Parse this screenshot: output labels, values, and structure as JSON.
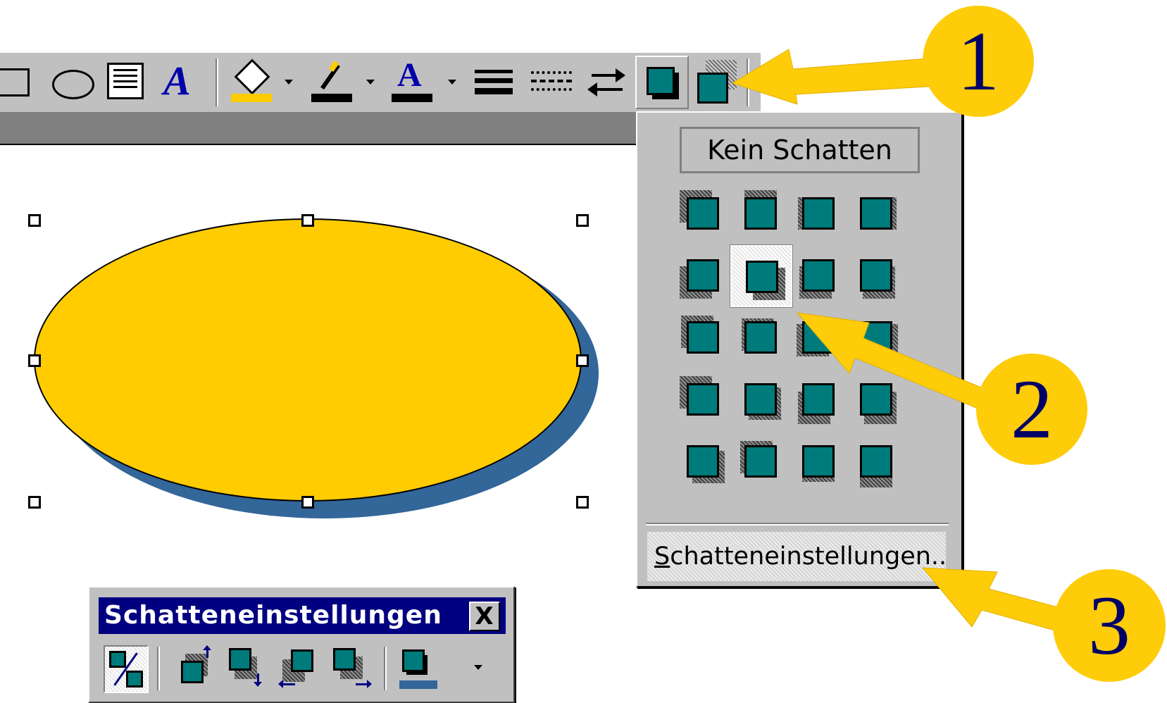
{
  "toolbar": {
    "tools": [
      "rectangle-icon",
      "oval-icon",
      "text-box-icon",
      "wordart-icon",
      "fill-color-icon",
      "line-color-icon",
      "font-color-icon",
      "line-style-icon",
      "dash-style-icon",
      "arrow-style-icon",
      "shadow-icon",
      "3d-icon"
    ],
    "font_color_glyph": "A"
  },
  "shadow_menu": {
    "no_shadow_label": "Kein Schatten",
    "settings_label_first": "S",
    "settings_label_rest": "chatteneinstellungen...",
    "shadow_style_count": 20,
    "selected_style": 6
  },
  "shadow_toolbar": {
    "title": "Schatteneinstellungen",
    "close_glyph": "X",
    "buttons": [
      "shadow-on-off-icon",
      "nudge-shadow-up-icon",
      "nudge-shadow-down-icon",
      "nudge-shadow-left-icon",
      "nudge-shadow-right-icon",
      "shadow-color-icon"
    ]
  },
  "callouts": [
    {
      "label": "1"
    },
    {
      "label": "2"
    },
    {
      "label": "3"
    }
  ],
  "colors": {
    "ellipse_fill": "#fecc00",
    "ellipse_shadow": "#336699",
    "callout_fill": "#fecc09",
    "callout_text": "#000066",
    "teal": "#007b7b",
    "title_bar": "#000080"
  }
}
